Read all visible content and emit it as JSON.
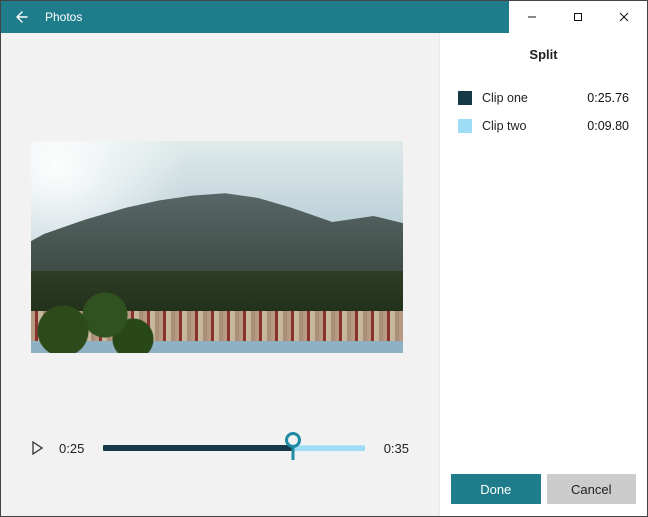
{
  "app": {
    "title": "Photos"
  },
  "timeline": {
    "current_time": "0:25",
    "total_time": "0:35",
    "split_ratio": 0.725
  },
  "panel": {
    "title": "Split",
    "clips": [
      {
        "label": "Clip one",
        "duration": "0:25.76",
        "color": "#163948"
      },
      {
        "label": "Clip two",
        "duration": "0:09.80",
        "color": "#9fdcf5"
      }
    ],
    "primary_button": "Done",
    "secondary_button": "Cancel"
  },
  "colors": {
    "accent": "#1f7c8a"
  }
}
